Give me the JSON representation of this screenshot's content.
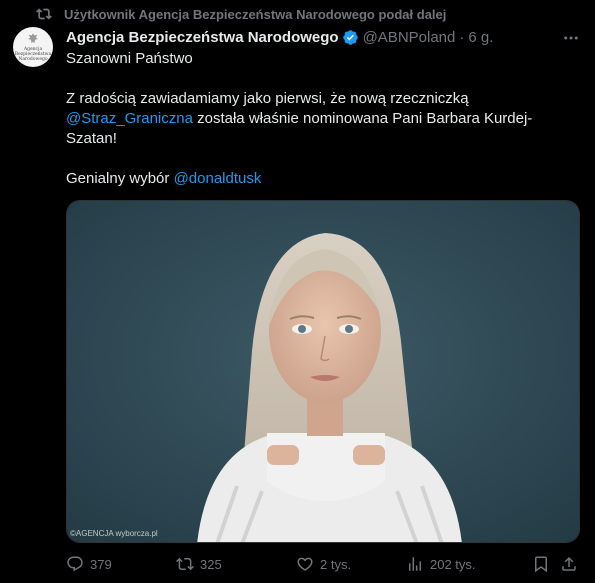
{
  "retweet": {
    "label": "Użytkownik Agencja Bezpieczeństwa Narodowego podał dalej"
  },
  "author": {
    "avatar_text": "Agencja Bezpieczeństwa Narodowego",
    "name": "Agencja Bezpieczeństwa Narodowego",
    "handle": "@ABNPoland",
    "separator": "·",
    "time": "6 g."
  },
  "tweet": {
    "line1": "Szanowni Państwo",
    "para2_text1": "Z radością zawiadamiamy jako pierwsi, że nową rzeczniczką",
    "para2_mention": "@Straz_Graniczna",
    "para2_text2": " została właśnie nominowana Pani Barbara Kurdej-Szatan!",
    "para3_text": "Genialny wybór ",
    "para3_mention": "@donaldtusk"
  },
  "photo": {
    "credit": "©AGENCJA wyborcza.pl"
  },
  "actions": {
    "replies": "379",
    "reposts": "325",
    "likes": "2 tys.",
    "views": "202 tys."
  },
  "colors": {
    "accent": "#1d9bf0",
    "muted": "#71767b",
    "text": "#e7e9ea",
    "background": "#000000"
  }
}
